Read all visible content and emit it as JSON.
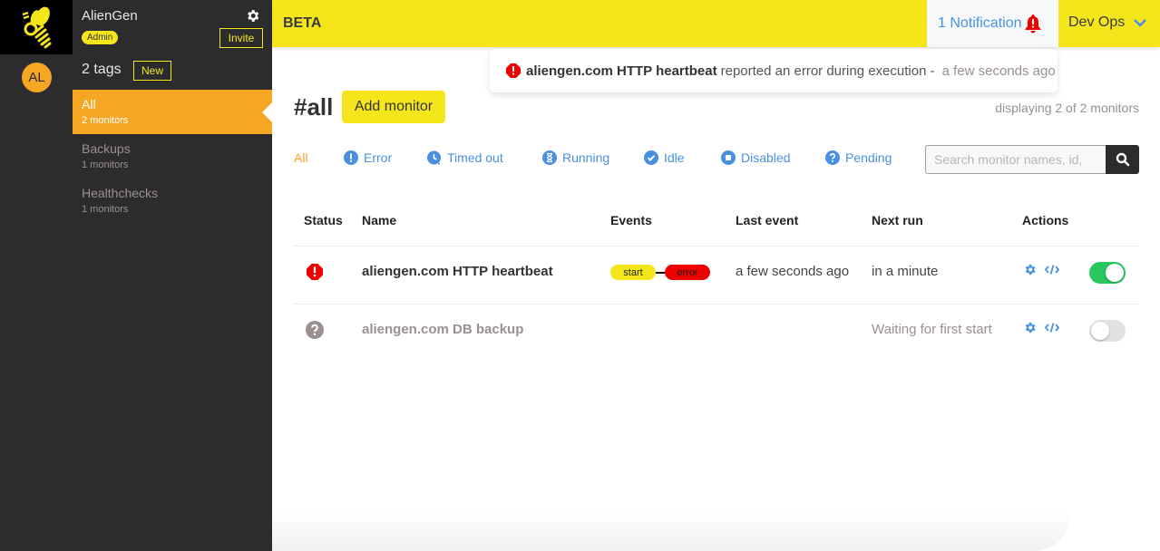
{
  "app": {
    "logo_icon": "bee-icon",
    "org_name": "AlienGen",
    "role_badge": "Admin",
    "invite_label": "Invite",
    "settings_icon": "gear-icon",
    "avatar_initials": "AL"
  },
  "sidebar": {
    "tags_count_label": "2 tags",
    "new_label": "New",
    "tags": [
      {
        "name": "All",
        "count": "2 monitors",
        "active": true
      },
      {
        "name": "Backups",
        "count": "1 monitors",
        "active": false
      },
      {
        "name": "Healthchecks",
        "count": "1 monitors",
        "active": false
      }
    ]
  },
  "topbar": {
    "beta_label": "BETA",
    "notifications_label": "1 Notification",
    "notifications_icon": "bell-alert-icon",
    "team_label": "Dev Ops",
    "team_icon": "chevron-down-icon"
  },
  "notification_popup": {
    "icon": "error-octagon-icon",
    "monitor_name": "aliengen.com HTTP heartbeat",
    "message": "reported an error during execution -",
    "time": "a few seconds ago"
  },
  "main": {
    "title": "#all",
    "add_monitor_label": "Add monitor",
    "displaying_label": "displaying 2 of 2 monitors",
    "filters": [
      {
        "label": "All",
        "icon": "",
        "active": true
      },
      {
        "label": "Error",
        "icon": "exclamation-circle-icon",
        "active": false
      },
      {
        "label": "Timed out",
        "icon": "clock-alert-icon",
        "active": false
      },
      {
        "label": "Running",
        "icon": "hourglass-icon",
        "active": false
      },
      {
        "label": "Idle",
        "icon": "check-circle-icon",
        "active": false
      },
      {
        "label": "Disabled",
        "icon": "stop-circle-icon",
        "active": false
      },
      {
        "label": "Pending",
        "icon": "question-circle-icon",
        "active": false
      }
    ],
    "search": {
      "placeholder": "Search monitor names, id,",
      "value": "",
      "button_icon": "search-icon"
    }
  },
  "table": {
    "headers": [
      "Status",
      "Name",
      "Events",
      "Last event",
      "Next run",
      "Actions"
    ],
    "rows": [
      {
        "status": "error",
        "status_icon": "error-octagon-icon",
        "name": "aliengen.com HTTP heartbeat",
        "events": [
          "start",
          "error"
        ],
        "last_event": "a few seconds ago",
        "next_run": "in a minute",
        "actions": [
          "gear-icon",
          "code-icon"
        ],
        "enabled": true
      },
      {
        "status": "pending",
        "status_icon": "question-circle-icon",
        "name": "aliengen.com DB backup",
        "events": [],
        "last_event": "",
        "next_run": "Waiting for first start",
        "actions": [
          "gear-icon",
          "code-icon"
        ],
        "enabled": false
      }
    ]
  },
  "colors": {
    "brand_yellow": "#f5e61c",
    "accent_orange": "#f5a623",
    "link_blue": "#4a90e2",
    "error_red": "#e00000",
    "toggle_on_green": "#27c75e",
    "sidebar_dark": "#2c2c2e"
  }
}
